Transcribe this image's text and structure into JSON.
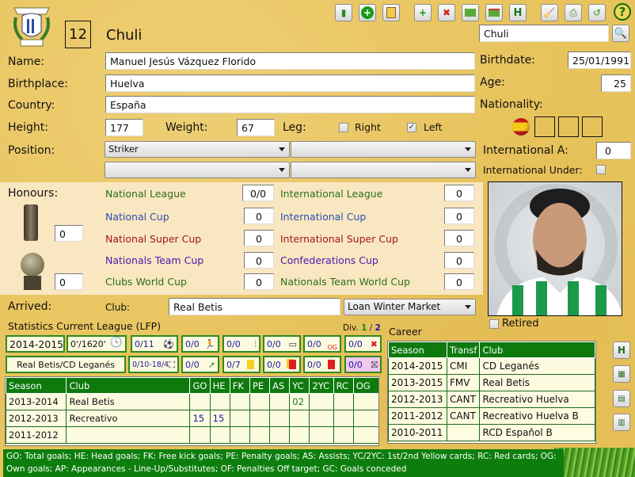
{
  "header": {
    "club_badge": "Club Deportivo Leganés crest",
    "shirt_number": "12",
    "nickname": "Chuli",
    "search_value": "Chuli"
  },
  "toolbar": {
    "icons": [
      "stats-chart-icon",
      "add-circle-icon",
      "clipboard-icon",
      "new-record-icon",
      "delete-record-icon",
      "folder-add-icon",
      "folder-remove-icon",
      "save-icon",
      "broom-clear-icon",
      "print-icon",
      "back-icon",
      "help-icon"
    ]
  },
  "personal": {
    "name_label": "Name:",
    "name_value": "Manuel Jesús Vázquez Florido",
    "birthplace_label": "Birthplace:",
    "birthplace_value": "Huelva",
    "country_label": "Country:",
    "country_value": "España",
    "height_label": "Height:",
    "height_value": "177",
    "weight_label": "Weight:",
    "weight_value": "67",
    "leg_label": "Leg:",
    "leg_right_label": "Right",
    "leg_right_checked": false,
    "leg_left_label": "Left",
    "leg_left_checked": true,
    "position_label": "Position:",
    "position_1": "Striker",
    "position_2": "",
    "position_3": "",
    "position_4": "",
    "birthdate_label": "Birthdate:",
    "birthdate_value": "25/01/1991",
    "age_label": "Age:",
    "age_value": "25",
    "nationality_label": "Nationality:",
    "nationality_flag": "spain-flag",
    "international_a_label": "International A:",
    "international_a_value": "0",
    "international_under_label": "International Under:",
    "international_under_checked": false,
    "retired_label": "Retired",
    "retired_checked": false
  },
  "honours": {
    "title": "Honours:",
    "trophy_1_value": "0",
    "trophy_2_value": "0",
    "items_left": [
      {
        "label": "National League",
        "value": "0/0",
        "color": "#2e6e1a"
      },
      {
        "label": "National Cup",
        "value": "0",
        "color": "#2a4fb0"
      },
      {
        "label": "National Super Cup",
        "value": "0",
        "color": "#a01818"
      },
      {
        "label": "Nationals Team Cup",
        "value": "0",
        "color": "#4a1ab0"
      },
      {
        "label": "Clubs World Cup",
        "value": "0",
        "color": "#2e6e1a"
      }
    ],
    "items_right": [
      {
        "label": "International League",
        "value": "0",
        "color": "#2e6e1a"
      },
      {
        "label": "International Cup",
        "value": "0",
        "color": "#2a4fb0"
      },
      {
        "label": "International Super Cup",
        "value": "0",
        "color": "#a01818"
      },
      {
        "label": "Confederations Cup",
        "value": "0",
        "color": "#4a1ab0"
      },
      {
        "label": "Nationals Team World Cup",
        "value": "0",
        "color": "#2e6e1a"
      }
    ]
  },
  "arrived": {
    "label": "Arrived:",
    "club_label": "Club:",
    "club_value": "Real Betis",
    "type_value": "Loan Winter Market"
  },
  "stats_current": {
    "title": "Statistics Current League (LFP)",
    "div_label": "Div.",
    "div_1": "1",
    "div_sep": "/",
    "div_2": "2",
    "season": "2014-2015",
    "minutes": "0'/1620'",
    "clubs": "Real Betis/CD Leganés",
    "row1": [
      {
        "value": "0/11",
        "icon": "ball-icon"
      },
      {
        "value": "0/0",
        "icon": "header-goal-icon"
      },
      {
        "value": "0/0",
        "icon": "free-kick-icon"
      },
      {
        "value": "0/0",
        "icon": "penalty-icon"
      },
      {
        "value": "0/0",
        "icon": "own-goal-icon"
      },
      {
        "value": "0/0",
        "icon": "penalty-missed-icon"
      }
    ],
    "row2": [
      {
        "value": "0/10-18/4",
        "icon": "appearances-icon"
      },
      {
        "value": "0/0",
        "icon": "assist-icon"
      },
      {
        "value": "0/7",
        "icon": "yellow-card-icon"
      },
      {
        "value": "0/0",
        "icon": "second-yellow-card-icon"
      },
      {
        "value": "0/0",
        "icon": "red-card-icon"
      },
      {
        "value": "0/0",
        "icon": "goals-conceded-icon"
      }
    ]
  },
  "stats_table": {
    "columns": [
      "Season",
      "Club",
      "GO",
      "HE",
      "FK",
      "PE",
      "AS",
      "YC",
      "2YC",
      "RC",
      "OG"
    ],
    "rows": [
      [
        "2013-2014",
        "Real Betis",
        "",
        "",
        "",
        "",
        "",
        "02",
        "",
        "",
        ""
      ],
      [
        "2012-2013",
        "Recreativo",
        "15",
        "15",
        "",
        "",
        "",
        "",
        "",
        "",
        ""
      ],
      [
        "2011-2012",
        "",
        "",
        "",
        "",
        "",
        "",
        "",
        "",
        "",
        ""
      ]
    ]
  },
  "career": {
    "title": "Career",
    "columns": [
      "Season",
      "Transf",
      "Club"
    ],
    "rows": [
      [
        "2014-2015",
        "CMI",
        "CD Leganés"
      ],
      [
        "2013-2015",
        "FMV",
        "Real Betis"
      ],
      [
        "2012-2013",
        "CANT",
        "Recreativo Huelva"
      ],
      [
        "2011-2012",
        "CANT",
        "Recreativo Huelva B"
      ],
      [
        "2010-2011",
        "",
        "RCD Español B"
      ]
    ]
  },
  "legend": {
    "text": "GO: Total goals; HE: Head goals; FK: Free kick goals; PE: Penalty goals; AS: Assists; YC/2YC: 1st/2nd Yellow cards; RC: Red cards; OG: Own goals; AP: Appearances - Line-Up/Substitutes; OF: Penalties Off target; GC: Goals conceded"
  }
}
